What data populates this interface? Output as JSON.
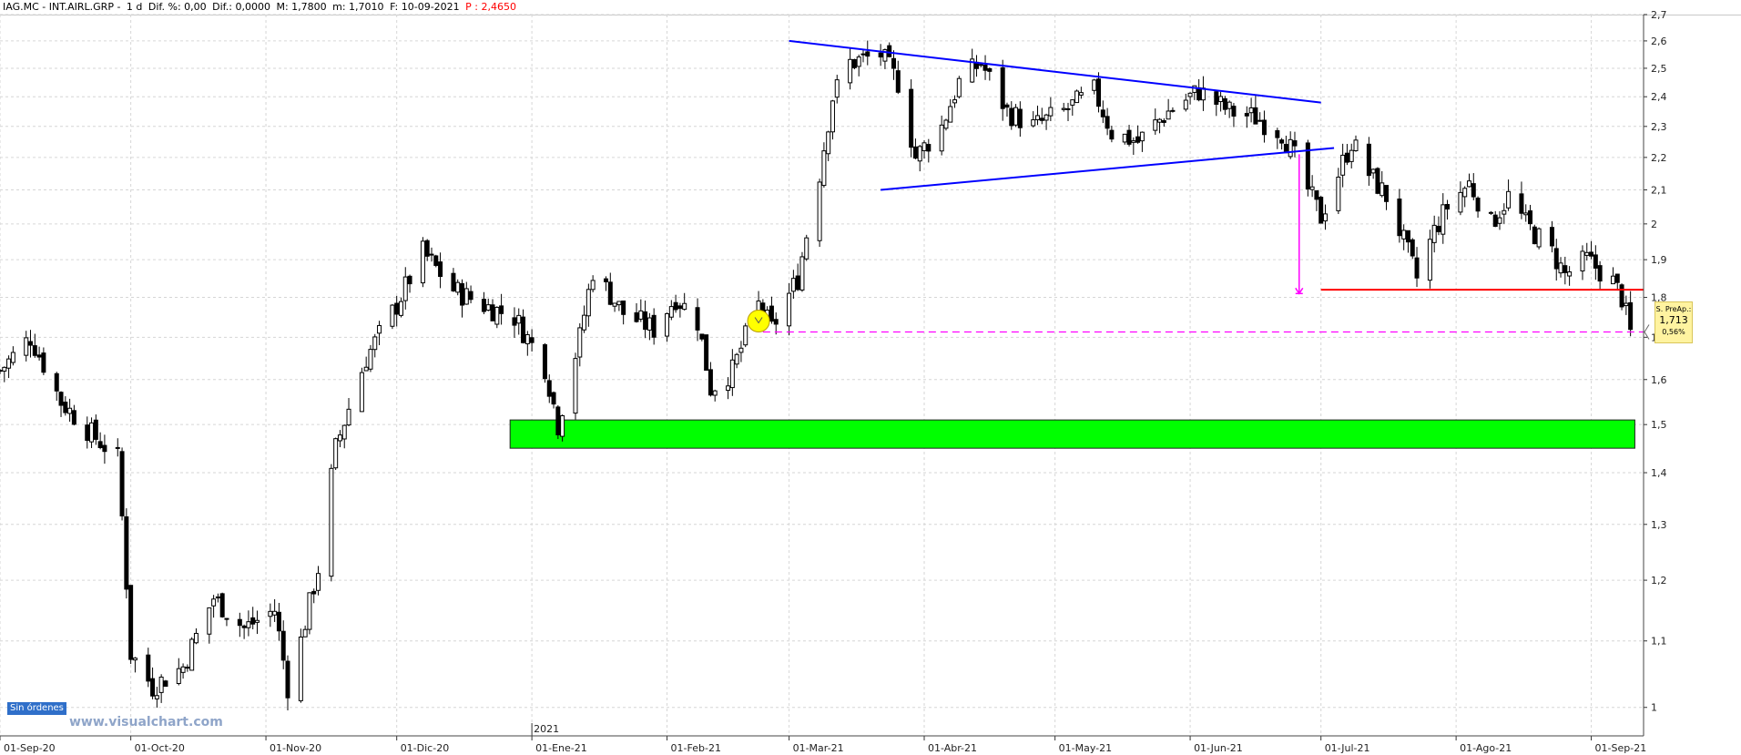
{
  "header": {
    "symbol": "IAG.MC - INT.AIRL.GRP -",
    "timeframe": "1 d",
    "dif_pct": "Dif. %: 0,00",
    "dif": "Dif.: 0,0000",
    "max": "M: 1,7800",
    "min": "m: 1,7010",
    "date": "F: 10-09-2021",
    "p_label": "P : 2,4650",
    "p_color": "#ff0000"
  },
  "badge_text": "Sin órdenes",
  "watermark": "www.visualchart.com",
  "price_box": {
    "label": "S. PreAp.:",
    "value": "1,713",
    "change": "0,56%"
  },
  "colors": {
    "trendline": "#0000ff",
    "support": "#ff0000",
    "target": "#ff00ff",
    "zone": "#00ff00",
    "marker": "#ffff00",
    "candle": "#000000"
  },
  "chart_data": {
    "type": "candlestick",
    "y_axis": {
      "min": 0.96,
      "max": 2.7,
      "scale": "log",
      "position": "right",
      "ticks": [
        "1",
        "1,1",
        "1,2",
        "1,3",
        "1,4",
        "1,5",
        "1,6",
        "1,7",
        "1,8",
        "1,9",
        "2",
        "2,1",
        "2,2",
        "2,3",
        "2,4",
        "2,5",
        "2,6",
        "2,7"
      ]
    },
    "x_axis": {
      "start": "2020-09-01",
      "end": "2021-09-10",
      "ticks": [
        {
          "date": "2020-09-01",
          "label": "01-Sep-20"
        },
        {
          "date": "2020-10-01",
          "label": "01-Oct-20"
        },
        {
          "date": "2020-11-01",
          "label": "01-Nov-20"
        },
        {
          "date": "2020-12-01",
          "label": "01-Dic-20"
        },
        {
          "date": "2021-01-01",
          "label": "01-Ene-21"
        },
        {
          "date": "2021-02-01",
          "label": "01-Feb-21"
        },
        {
          "date": "2021-03-01",
          "label": "01-Mar-21"
        },
        {
          "date": "2021-04-01",
          "label": "01-Abr-21"
        },
        {
          "date": "2021-05-01",
          "label": "01-May-21"
        },
        {
          "date": "2021-06-01",
          "label": "01-Jun-21"
        },
        {
          "date": "2021-07-01",
          "label": "01-Jul-21"
        },
        {
          "date": "2021-08-01",
          "label": "01-Ago-21"
        },
        {
          "date": "2021-09-01",
          "label": "01-Sep-21"
        }
      ],
      "year_marker": {
        "date": "2021-01-01",
        "label": "2021"
      }
    },
    "grid": true,
    "legend": "none",
    "anchors": [
      [
        "2020-09-01",
        1.62
      ],
      [
        "2020-09-08",
        1.7
      ],
      [
        "2020-09-15",
        1.55
      ],
      [
        "2020-09-22",
        1.48
      ],
      [
        "2020-09-28",
        1.43
      ],
      [
        "2020-10-01",
        1.08
      ],
      [
        "2020-10-06",
        1.03
      ],
      [
        "2020-10-13",
        1.06
      ],
      [
        "2020-10-20",
        1.17
      ],
      [
        "2020-10-27",
        1.12
      ],
      [
        "2020-11-03",
        1.15
      ],
      [
        "2020-11-06",
        1.03
      ],
      [
        "2020-11-09",
        1.1
      ],
      [
        "2020-11-13",
        1.22
      ],
      [
        "2020-11-17",
        1.45
      ],
      [
        "2020-11-24",
        1.65
      ],
      [
        "2020-12-01",
        1.78
      ],
      [
        "2020-12-07",
        1.92
      ],
      [
        "2020-12-14",
        1.82
      ],
      [
        "2020-12-21",
        1.78
      ],
      [
        "2020-12-28",
        1.75
      ],
      [
        "2021-01-04",
        1.63
      ],
      [
        "2021-01-07",
        1.5
      ],
      [
        "2021-01-12",
        1.7
      ],
      [
        "2021-01-15",
        1.87
      ],
      [
        "2021-01-22",
        1.76
      ],
      [
        "2021-01-29",
        1.72
      ],
      [
        "2021-02-03",
        1.8
      ],
      [
        "2021-02-08",
        1.74
      ],
      [
        "2021-02-11",
        1.58
      ],
      [
        "2021-02-16",
        1.62
      ],
      [
        "2021-02-22",
        1.78
      ],
      [
        "2021-02-25",
        1.72
      ],
      [
        "2021-03-03",
        1.85
      ],
      [
        "2021-03-08",
        2.15
      ],
      [
        "2021-03-11",
        2.4
      ],
      [
        "2021-03-15",
        2.52
      ],
      [
        "2021-03-22",
        2.55
      ],
      [
        "2021-03-26",
        2.45
      ],
      [
        "2021-03-30",
        2.2
      ],
      [
        "2021-04-05",
        2.3
      ],
      [
        "2021-04-09",
        2.45
      ],
      [
        "2021-04-14",
        2.52
      ],
      [
        "2021-04-20",
        2.35
      ],
      [
        "2021-04-26",
        2.3
      ],
      [
        "2021-05-03",
        2.35
      ],
      [
        "2021-05-10",
        2.42
      ],
      [
        "2021-05-14",
        2.28
      ],
      [
        "2021-05-20",
        2.25
      ],
      [
        "2021-05-27",
        2.35
      ],
      [
        "2021-06-03",
        2.42
      ],
      [
        "2021-06-10",
        2.35
      ],
      [
        "2021-06-16",
        2.33
      ],
      [
        "2021-06-22",
        2.28
      ],
      [
        "2021-06-25",
        2.2
      ],
      [
        "2021-06-28",
        2.1
      ],
      [
        "2021-07-01",
        2.02
      ],
      [
        "2021-07-05",
        2.15
      ],
      [
        "2021-07-08",
        2.25
      ],
      [
        "2021-07-12",
        2.15
      ],
      [
        "2021-07-16",
        2.08
      ],
      [
        "2021-07-20",
        1.95
      ],
      [
        "2021-07-23",
        1.85
      ],
      [
        "2021-07-27",
        1.98
      ],
      [
        "2021-07-30",
        2.05
      ],
      [
        "2021-08-04",
        2.12
      ],
      [
        "2021-08-09",
        2.0
      ],
      [
        "2021-08-13",
        2.08
      ],
      [
        "2021-08-17",
        2.0
      ],
      [
        "2021-08-23",
        1.92
      ],
      [
        "2021-08-26",
        1.86
      ],
      [
        "2021-08-31",
        1.9
      ],
      [
        "2021-09-06",
        1.84
      ],
      [
        "2021-09-08",
        1.8
      ],
      [
        "2021-09-10",
        1.71
      ]
    ],
    "annotations": {
      "triangle_upper": [
        [
          "2021-03-01",
          2.6
        ],
        [
          "2021-07-01",
          2.38
        ]
      ],
      "triangle_lower": [
        [
          "2021-03-22",
          2.1
        ],
        [
          "2021-07-04",
          2.23
        ]
      ],
      "support_line": [
        [
          "2021-07-01",
          1.82
        ],
        [
          "2021-09-13",
          1.82
        ]
      ],
      "target_arrow": {
        "date": "2021-06-26",
        "from": 2.21,
        "to": 1.81
      },
      "reference_line": {
        "value": 1.713,
        "from": "2021-02-23",
        "to": "2021-09-13"
      },
      "demand_zone": {
        "from": "2020-12-27",
        "to": "2021-09-11",
        "low": 1.45,
        "high": 1.51
      },
      "marker": {
        "date": "2021-02-22",
        "value": 1.74
      }
    }
  }
}
